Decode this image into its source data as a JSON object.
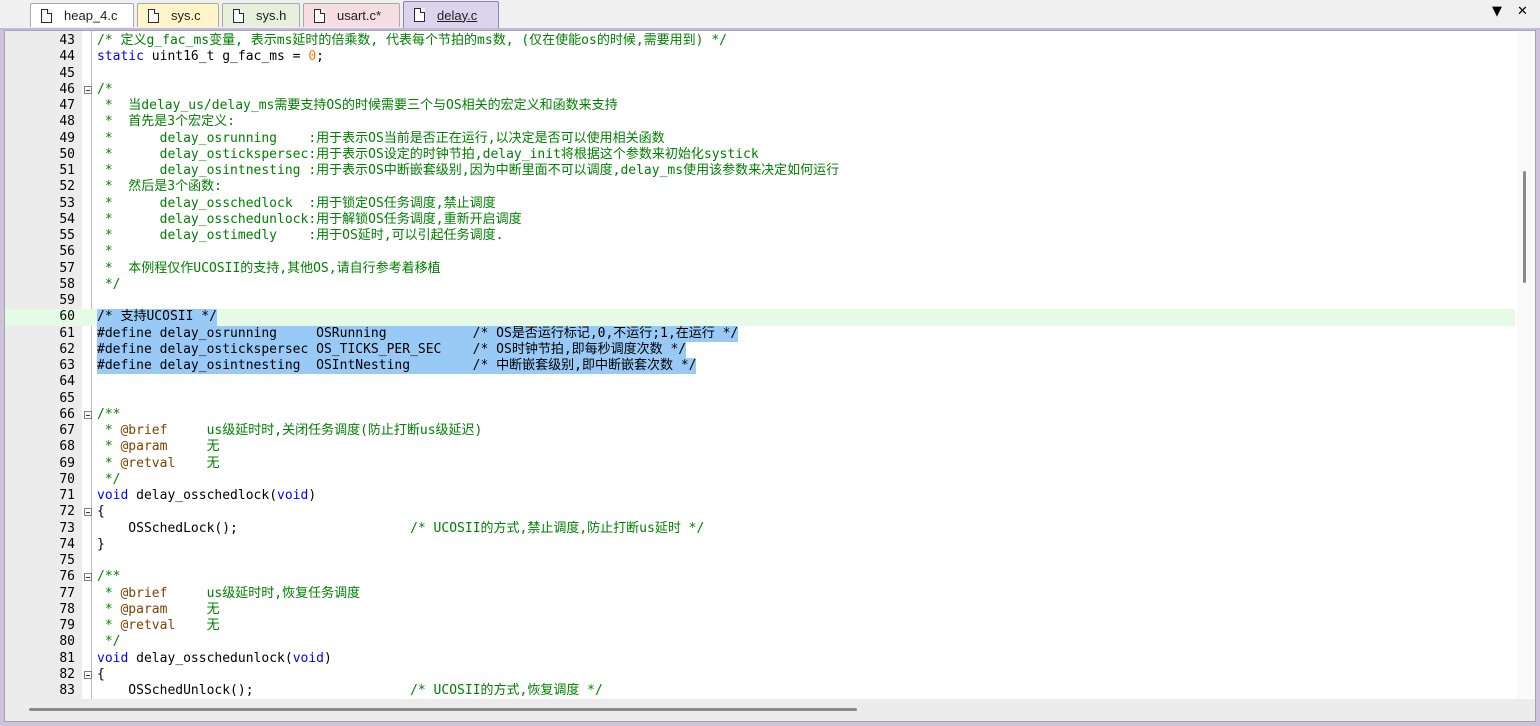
{
  "tabs": [
    {
      "label": "heap_4.c",
      "color": "#ffffff"
    },
    {
      "label": "sys.c",
      "color": "#fff5c8"
    },
    {
      "label": "sys.h",
      "color": "#e6f0dc"
    },
    {
      "label": "usart.c*",
      "color": "#f5dde2"
    },
    {
      "label": "delay.c",
      "color": "#dcd3ec",
      "active": true
    }
  ],
  "tab_controls": {
    "dropdown": "▼",
    "close": "✕"
  },
  "editor": {
    "current_line": "60",
    "lines": [
      {
        "n": "43",
        "text": "/* 定义g_fac_ms变量, 表示ms延时的倍乘数, 代表每个节拍的ms数, (仅在使能os的时候,需要用到) */",
        "kind": "comment"
      },
      {
        "n": "44",
        "text": "static uint16_t g_fac_ms = 0;",
        "kind": "code"
      },
      {
        "n": "45",
        "text": "",
        "kind": "code"
      },
      {
        "n": "46",
        "text": "/*",
        "kind": "comment",
        "fold": true
      },
      {
        "n": "47",
        "text": " *  当delay_us/delay_ms需要支持OS的时候需要三个与OS相关的宏定义和函数来支持",
        "kind": "comment"
      },
      {
        "n": "48",
        "text": " *  首先是3个宏定义:",
        "kind": "comment"
      },
      {
        "n": "49",
        "text": " *      delay_osrunning    :用于表示OS当前是否正在运行,以决定是否可以使用相关函数",
        "kind": "comment"
      },
      {
        "n": "50",
        "text": " *      delay_ostickspersec:用于表示OS设定的时钟节拍,delay_init将根据这个参数来初始化systick",
        "kind": "comment"
      },
      {
        "n": "51",
        "text": " *      delay_osintnesting :用于表示OS中断嵌套级别,因为中断里面不可以调度,delay_ms使用该参数来决定如何运行",
        "kind": "comment"
      },
      {
        "n": "52",
        "text": " *  然后是3个函数:",
        "kind": "comment"
      },
      {
        "n": "53",
        "text": " *      delay_osschedlock  :用于锁定OS任务调度,禁止调度",
        "kind": "comment"
      },
      {
        "n": "54",
        "text": " *      delay_osschedunlock:用于解锁OS任务调度,重新开启调度",
        "kind": "comment"
      },
      {
        "n": "55",
        "text": " *      delay_ostimedly    :用于OS延时,可以引起任务调度.",
        "kind": "comment"
      },
      {
        "n": "56",
        "text": " *",
        "kind": "comment"
      },
      {
        "n": "57",
        "text": " *  本例程仅作UCOSII的支持,其他OS,请自行参考着移植",
        "kind": "comment"
      },
      {
        "n": "58",
        "text": " */",
        "kind": "comment"
      },
      {
        "n": "59",
        "text": "",
        "kind": "code"
      },
      {
        "n": "60",
        "text": "/* 支持UCOSII */",
        "kind": "selected"
      },
      {
        "n": "61",
        "text": "#define delay_osrunning     OSRunning           /* OS是否运行标记,0,不运行;1,在运行 */",
        "kind": "selected"
      },
      {
        "n": "62",
        "text": "#define delay_ostickspersec OS_TICKS_PER_SEC    /* OS时钟节拍,即每秒调度次数 */",
        "kind": "selected"
      },
      {
        "n": "63",
        "text": "#define delay_osintnesting  OSIntNesting        /* 中断嵌套级别,即中断嵌套次数 */",
        "kind": "selected"
      },
      {
        "n": "64",
        "text": "",
        "kind": "code"
      },
      {
        "n": "65",
        "text": "",
        "kind": "code"
      },
      {
        "n": "66",
        "text": "/**",
        "kind": "comment",
        "fold": true
      },
      {
        "n": "67",
        "text": " * @brief     us级延时时,关闭任务调度(防止打断us级延迟)",
        "kind": "doc",
        "tag": "@brief"
      },
      {
        "n": "68",
        "text": " * @param     无",
        "kind": "doc",
        "tag": "@param"
      },
      {
        "n": "69",
        "text": " * @retval    无",
        "kind": "doc",
        "tag": "@retval"
      },
      {
        "n": "70",
        "text": " */",
        "kind": "comment"
      },
      {
        "n": "71",
        "text": "void delay_osschedlock(void)",
        "kind": "func"
      },
      {
        "n": "72",
        "text": "{",
        "kind": "code",
        "fold": true
      },
      {
        "n": "73",
        "text": "    OSSchedLock();                      /* UCOSII的方式,禁止调度,防止打断us延时 */",
        "kind": "call"
      },
      {
        "n": "74",
        "text": "}",
        "kind": "code"
      },
      {
        "n": "75",
        "text": "",
        "kind": "code"
      },
      {
        "n": "76",
        "text": "/**",
        "kind": "comment",
        "fold": true
      },
      {
        "n": "77",
        "text": " * @brief     us级延时时,恢复任务调度",
        "kind": "doc",
        "tag": "@brief"
      },
      {
        "n": "78",
        "text": " * @param     无",
        "kind": "doc",
        "tag": "@param"
      },
      {
        "n": "79",
        "text": " * @retval    无",
        "kind": "doc",
        "tag": "@retval"
      },
      {
        "n": "80",
        "text": " */",
        "kind": "comment"
      },
      {
        "n": "81",
        "text": "void delay_osschedunlock(void)",
        "kind": "func"
      },
      {
        "n": "82",
        "text": "{",
        "kind": "code",
        "fold": true
      },
      {
        "n": "83",
        "text": "    OSSchedUnlock();                    /* UCOSII的方式,恢复调度 */",
        "kind": "call"
      }
    ]
  }
}
